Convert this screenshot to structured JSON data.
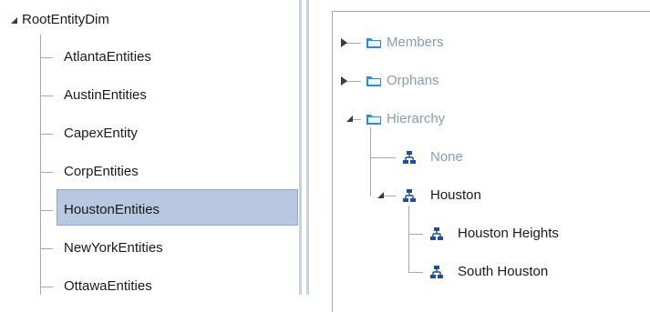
{
  "left_tree": {
    "root": {
      "label": "RootEntityDim",
      "icon": "expanded-arrow-icon"
    },
    "items": [
      {
        "label": "AtlantaEntities",
        "selected": false
      },
      {
        "label": "AustinEntities",
        "selected": false
      },
      {
        "label": "CapexEntity",
        "selected": false
      },
      {
        "label": "CorpEntities",
        "selected": false
      },
      {
        "label": "HoustonEntities",
        "selected": true
      },
      {
        "label": "NewYorkEntities",
        "selected": false
      },
      {
        "label": "OttawaEntities",
        "selected": false
      }
    ]
  },
  "right_tree": {
    "members": {
      "label": "Members",
      "icon": "folder-icon",
      "expanded": false
    },
    "orphans": {
      "label": "Orphans",
      "icon": "folder-icon",
      "expanded": false
    },
    "hierarchy": {
      "label": "Hierarchy",
      "icon": "folder-icon",
      "expanded": true
    },
    "none": {
      "label": "None",
      "icon": "hierarchy-icon"
    },
    "houston": {
      "label": "Houston",
      "icon": "hierarchy-icon",
      "expanded": true
    },
    "houston_heights": {
      "label": "Houston Heights",
      "icon": "hierarchy-icon"
    },
    "south_houston": {
      "label": "South Houston",
      "icon": "hierarchy-icon"
    }
  },
  "colors": {
    "selection": "#b8c8e0",
    "folder": "#2c8fd6",
    "hierarchy_icon": "#1f4e9c",
    "dim_text": "#8a9bb5",
    "splitter": "#c5d0e2"
  }
}
